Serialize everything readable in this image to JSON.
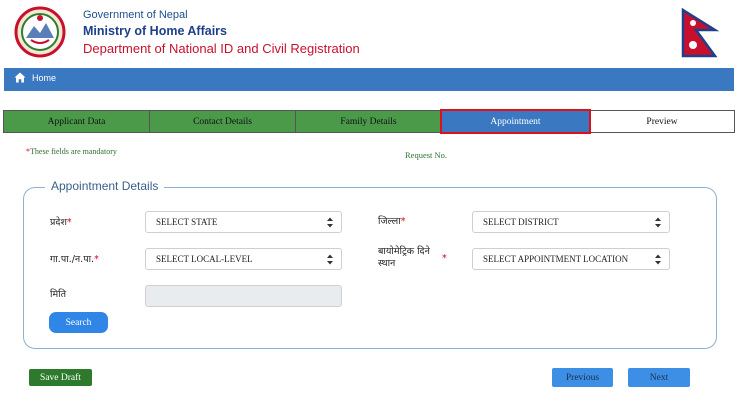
{
  "header": {
    "line1": "Government of Nepal",
    "line2": "Ministry of Home Affairs",
    "line3": "Department of National ID and Civil Registration"
  },
  "nav": {
    "home_label": "Home"
  },
  "tabs": [
    {
      "label": "Applicant Data",
      "state": "done"
    },
    {
      "label": "Contact Details",
      "state": "done"
    },
    {
      "label": "Family Details",
      "state": "done"
    },
    {
      "label": "Appointment",
      "state": "active"
    },
    {
      "label": "Preview",
      "state": "pending"
    }
  ],
  "form": {
    "mandatory_star": "*",
    "mandatory_note": "These fields are mandatory",
    "request_no_label": "Request No.",
    "section_title": "Appointment Details",
    "state_label": "प्रदेश",
    "state_value": "SELECT STATE",
    "district_label": "जिल्ला",
    "district_value": "SELECT DISTRICT",
    "local_level_label": "गा.पा./न.पा.",
    "local_level_value": "SELECT LOCAL-LEVEL",
    "location_label_1": "बायोमेट्रिक दिने",
    "location_label_2": "स्थान",
    "location_value": "SELECT APPOINTMENT LOCATION",
    "date_label": "मिति",
    "date_value": "",
    "required_mark": "*",
    "search_label": "Search"
  },
  "footer": {
    "save_draft_label": "Save Draft",
    "previous_label": "Previous",
    "next_label": "Next"
  },
  "colors": {
    "nav_blue": "#3a78c2",
    "tab_done_green": "#4a9a4a",
    "active_outline_red": "#e0101a",
    "button_blue": "#3d8fe6",
    "draft_green": "#2d7a2d"
  }
}
